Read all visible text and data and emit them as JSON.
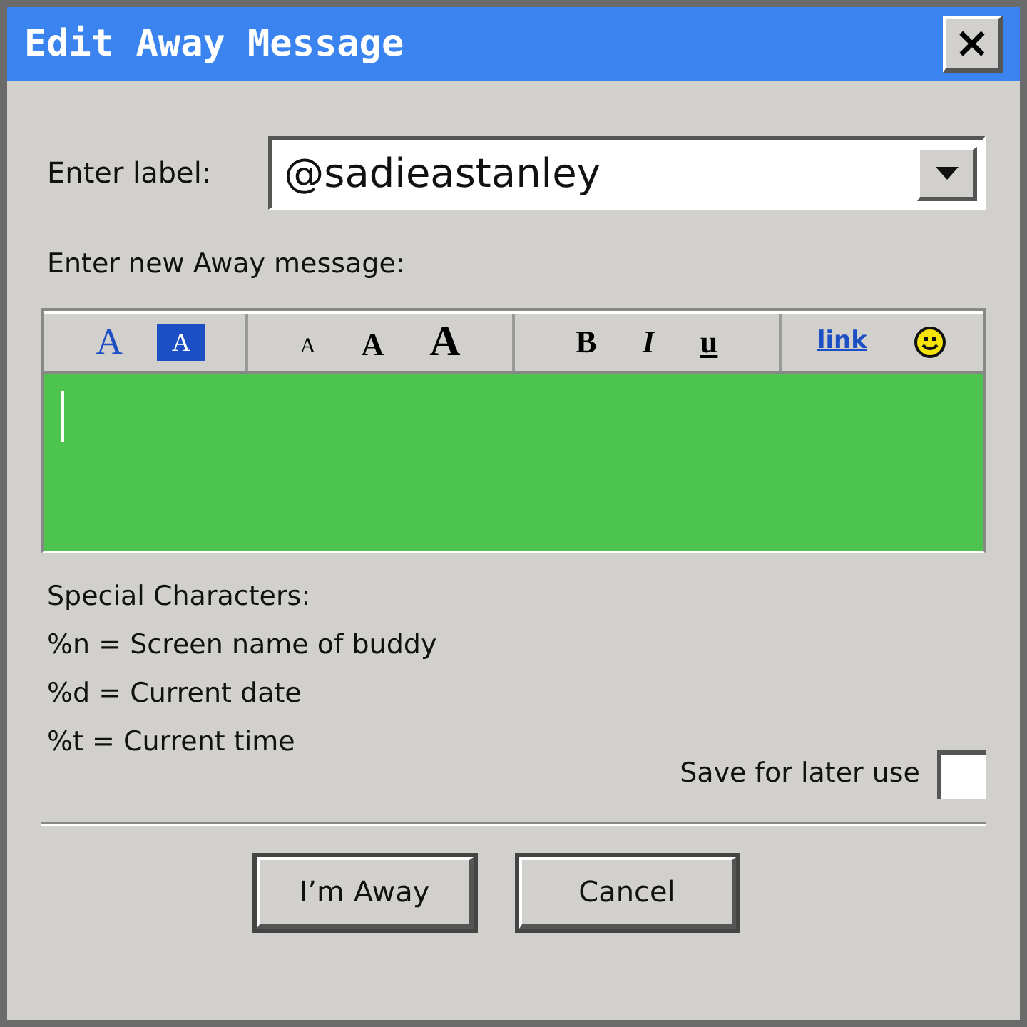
{
  "window": {
    "title": "Edit Away Message",
    "close": "×"
  },
  "label_field": {
    "label": "Enter label:",
    "value": "@sadieastanley"
  },
  "message": {
    "label": "Enter new Away message:",
    "toolbar": [
      [
        {
          "kind": "text-color",
          "label": "A"
        },
        {
          "kind": "back-color",
          "label": "A"
        }
      ],
      [
        {
          "kind": "small",
          "label": "A"
        },
        {
          "kind": "medium",
          "label": "A"
        },
        {
          "kind": "large",
          "label": "A"
        }
      ],
      [
        {
          "kind": "bold",
          "label": "B"
        },
        {
          "kind": "italic",
          "label": "I"
        },
        {
          "kind": "underline",
          "label": "u"
        }
      ],
      [
        {
          "kind": "link",
          "label": "link"
        },
        {
          "kind": "smiley"
        }
      ]
    ]
  },
  "special_characters": [
    "Special Characters:",
    "%n = Screen name of buddy",
    "%d = Current date",
    "%t = Current time"
  ],
  "save": {
    "label": "Save for later use",
    "checked": false
  },
  "buttons": [
    "I’m Away",
    "Cancel"
  ]
}
